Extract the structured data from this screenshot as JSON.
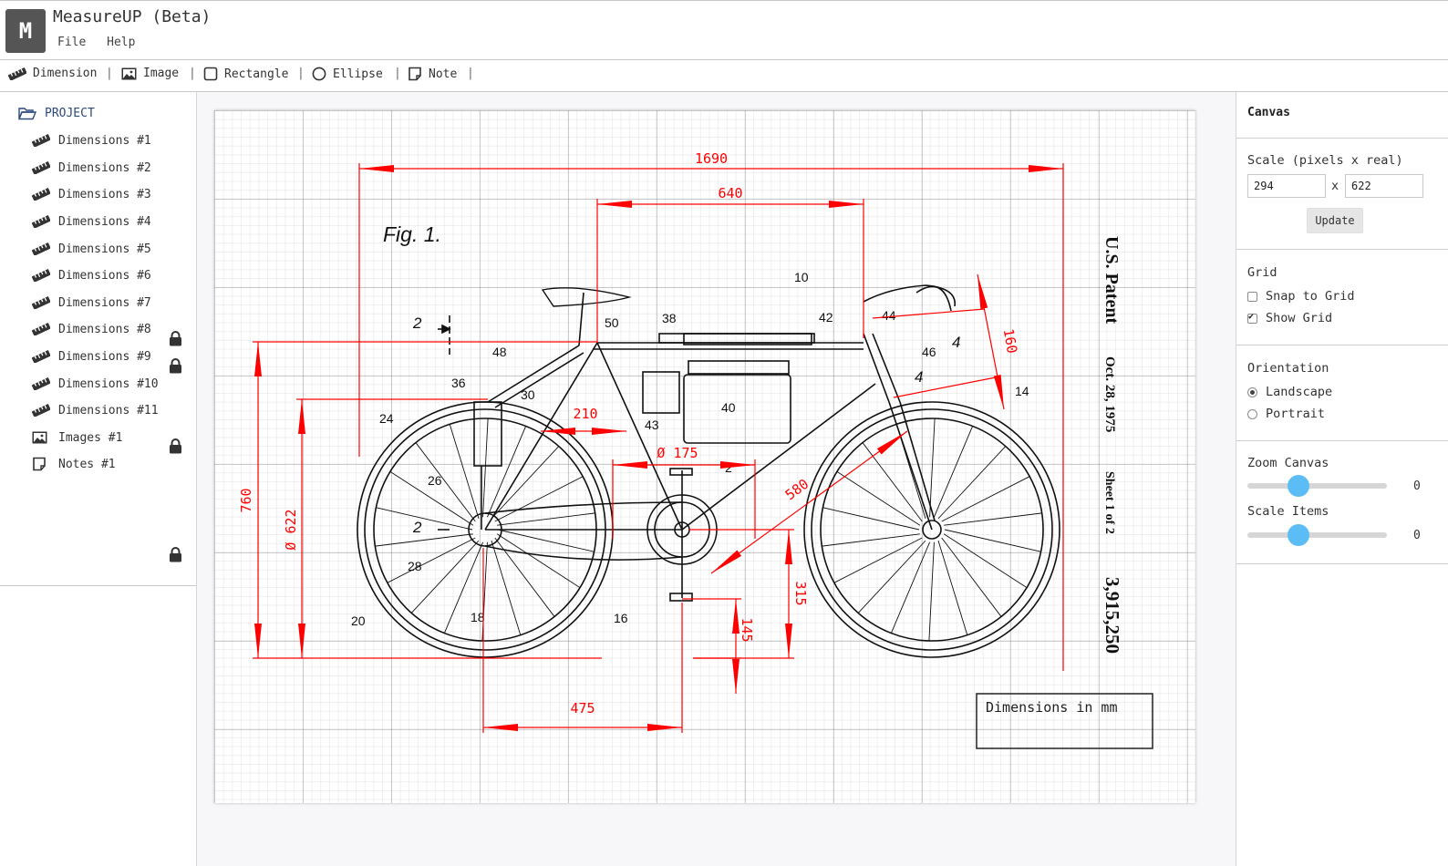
{
  "app": {
    "logo_letter": "M",
    "title": "MeasureUP (Beta)"
  },
  "menu": {
    "file": "File",
    "help": "Help"
  },
  "toolbar": {
    "dimension": "Dimension",
    "image": "Image",
    "rectangle": "Rectangle",
    "ellipse": "Ellipse",
    "note": "Note",
    "separator": "|"
  },
  "sidebar": {
    "project_label": "PROJECT",
    "items": [
      {
        "label": "Dimensions #1",
        "icon": "ruler-icon",
        "locked": false
      },
      {
        "label": "Dimensions #2",
        "icon": "ruler-icon",
        "locked": false
      },
      {
        "label": "Dimensions #3",
        "icon": "ruler-icon",
        "locked": false
      },
      {
        "label": "Dimensions #4",
        "icon": "ruler-icon",
        "locked": true
      },
      {
        "label": "Dimensions #5",
        "icon": "ruler-icon",
        "locked": true
      },
      {
        "label": "Dimensions #6",
        "icon": "ruler-icon",
        "locked": false
      },
      {
        "label": "Dimensions #7",
        "icon": "ruler-icon",
        "locked": false
      },
      {
        "label": "Dimensions #8",
        "icon": "ruler-icon",
        "locked": true
      },
      {
        "label": "Dimensions #9",
        "icon": "ruler-icon",
        "locked": false
      },
      {
        "label": "Dimensions #10",
        "icon": "ruler-icon",
        "locked": false
      },
      {
        "label": "Dimensions #11",
        "icon": "ruler-icon",
        "locked": false
      },
      {
        "label": "Images #1",
        "icon": "image-icon",
        "locked": true
      },
      {
        "label": "Notes #1",
        "icon": "note-icon",
        "locked": false
      }
    ]
  },
  "drawing": {
    "fig_label": "Fig. 1.",
    "patent_title": "U.S. Patent",
    "patent_date": "Oct. 28, 1975",
    "patent_sheet": "Sheet 1 of 2",
    "patent_number": "3,915,250",
    "note_text": "Dimensions in mm",
    "accent_color": "#ff0000",
    "dimensions": {
      "overall_length": "1690",
      "battery_length": "640",
      "bar_reach": "160",
      "crank_offset": "210",
      "chainring": "Ø 175",
      "seat_tube": "580",
      "height": "760",
      "wheel": "Ø 622",
      "bb_height": "315",
      "bb_drop": "145",
      "chainstay": "475"
    },
    "part_numbers": [
      "10",
      "50",
      "38",
      "42",
      "44",
      "46",
      "4",
      "4",
      "14",
      "48",
      "36",
      "30",
      "24",
      "40",
      "43",
      "26",
      "2",
      "2",
      "28",
      "18",
      "20",
      "16",
      "2"
    ]
  },
  "panel": {
    "canvas_title": "Canvas",
    "scale_label": "Scale (pixels x real)",
    "scale_px": "294",
    "scale_x": "x",
    "scale_real": "622",
    "update_label": "Update",
    "grid_label": "Grid",
    "snap_label": "Snap to Grid",
    "snap_on": false,
    "show_grid_label": "Show Grid",
    "show_grid_on": true,
    "orientation_label": "Orientation",
    "landscape_label": "Landscape",
    "portrait_label": "Portrait",
    "orientation": "landscape",
    "zoom_label": "Zoom Canvas",
    "zoom_value": "0",
    "scale_items_label": "Scale Items",
    "scale_items_value": "0",
    "slider_color": "#5bbcf6"
  }
}
